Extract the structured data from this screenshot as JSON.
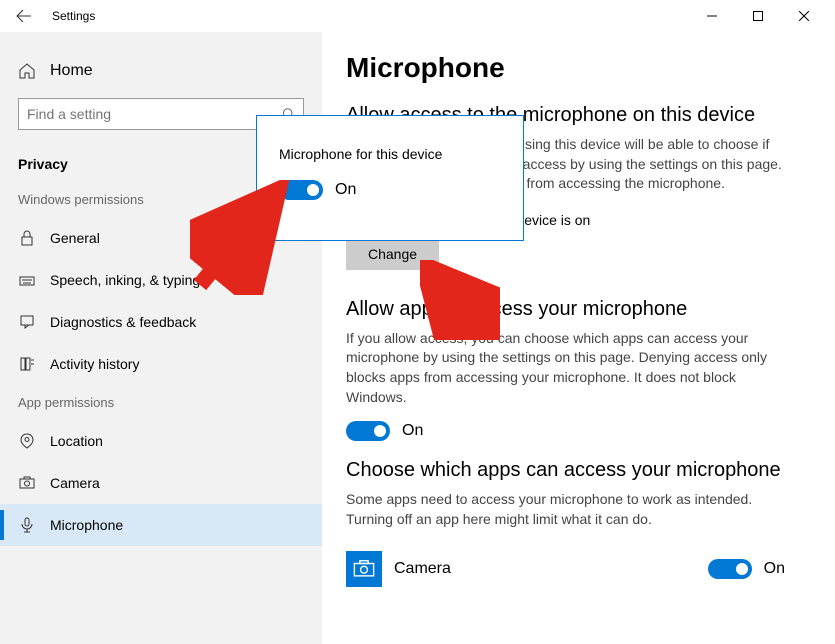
{
  "titlebar": {
    "title": "Settings"
  },
  "sidebar": {
    "home": "Home",
    "search_placeholder": "Find a setting",
    "current_section": "Privacy",
    "group1_label": "Windows permissions",
    "group1": [
      {
        "label": "General"
      },
      {
        "label": "Speech, inking, & typing"
      },
      {
        "label": "Diagnostics & feedback"
      },
      {
        "label": "Activity history"
      }
    ],
    "group2_label": "App permissions",
    "group2": [
      {
        "label": "Location"
      },
      {
        "label": "Camera"
      },
      {
        "label": "Microphone"
      }
    ]
  },
  "main": {
    "title": "Microphone",
    "section1_h": "Allow access to the microphone on this device",
    "section1_desc": "If you allow access, people using this device will be able to choose if their apps have microphone access by using the settings on this page. Denying access blocks apps from accessing the microphone.",
    "status": "Microphone access for this device is on",
    "change_btn": "Change",
    "section2_h": "Allow apps to access your microphone",
    "section2_desc": "If you allow access, you can choose which apps can access your microphone by using the settings on this page. Denying access only blocks apps from accessing your microphone. It does not block Windows.",
    "toggle2_state": "On",
    "section3_h": "Choose which apps can access your microphone",
    "section3_desc": "Some apps need to access your microphone to work as intended. Turning off an app here might limit what it can do.",
    "app1_name": "Camera",
    "app1_state": "On"
  },
  "popup": {
    "title": "Microphone for this device",
    "state": "On"
  }
}
